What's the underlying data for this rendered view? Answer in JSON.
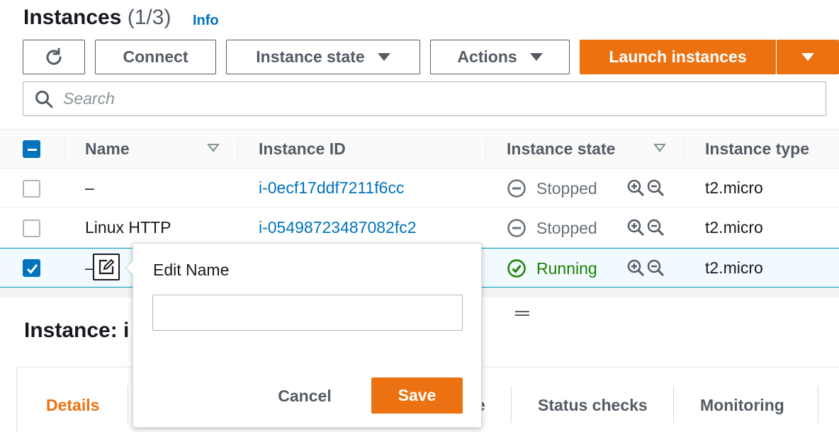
{
  "header": {
    "title": "Instances",
    "count": "(1/3)",
    "info_link": "Info"
  },
  "toolbar": {
    "connect": "Connect",
    "instance_state": "Instance state",
    "actions": "Actions",
    "launch": "Launch instances"
  },
  "search": {
    "placeholder": "Search"
  },
  "table": {
    "columns": [
      "Name",
      "Instance ID",
      "Instance state",
      "Instance type"
    ],
    "rows": [
      {
        "name": "–",
        "id": "i-0ecf17ddf7211f6cc",
        "state": "Stopped",
        "type": "t2.micro",
        "selected": false
      },
      {
        "name": "Linux HTTP",
        "id": "i-05498723487082fc2",
        "state": "Stopped",
        "type": "t2.micro",
        "selected": false
      },
      {
        "name": "–",
        "id": "",
        "state": "Running",
        "type": "t2.micro",
        "selected": true
      }
    ]
  },
  "popover": {
    "label": "Edit Name",
    "value": "",
    "cancel": "Cancel",
    "save": "Save"
  },
  "detail": {
    "title": "Instance: i"
  },
  "tabs": {
    "details": "Details",
    "partial": "e",
    "status_checks": "Status checks",
    "monitoring": "Monitoring"
  },
  "colors": {
    "accent": "#ec7211",
    "link": "#0073bb",
    "running": "#1d8102",
    "stopped": "#687078"
  }
}
